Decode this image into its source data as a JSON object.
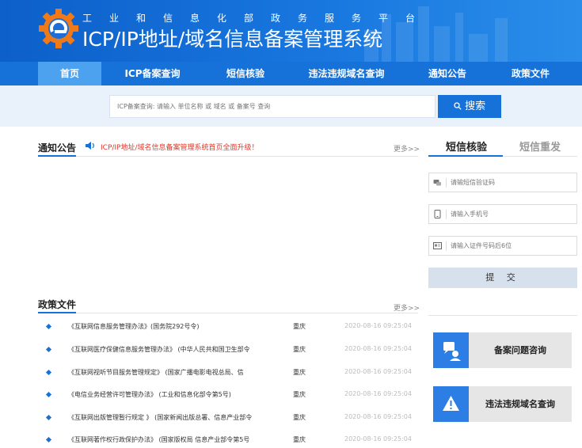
{
  "header": {
    "subtitle": "工业和信息化部政务服务平台",
    "title": "ICP/IP地址/域名信息备案管理系统"
  },
  "nav": {
    "items": [
      {
        "label": "首页",
        "active": true
      },
      {
        "label": "ICP备案查询"
      },
      {
        "label": "短信核验"
      },
      {
        "label": "违法违规域名查询"
      },
      {
        "label": "通知公告"
      },
      {
        "label": "政策文件"
      }
    ]
  },
  "search": {
    "placeholder": "ICP备案查询: 请输入 单位名称 或 域名 或 备案号 查询",
    "button_label": "搜索"
  },
  "notice": {
    "title": "通知公告",
    "headline": "ICP/IP地址/域名信息备案管理系统首页全面升级！",
    "more": "更多>>"
  },
  "sms": {
    "tabs": [
      {
        "label": "短信核验",
        "active": true
      },
      {
        "label": "短信重发",
        "active": false
      }
    ],
    "fields": [
      {
        "placeholder": "请输短信验证码",
        "icon": "chat-icon"
      },
      {
        "placeholder": "请输入手机号",
        "icon": "phone-icon"
      },
      {
        "placeholder": "请输入证件号码后6位",
        "icon": "id-card-icon"
      }
    ],
    "submit_label": "提 交"
  },
  "policy": {
    "title": "政策文件",
    "more": "更多>>",
    "rows": [
      {
        "title": "《互联网信息服务管理办法》(国务院292号令)",
        "region": "重庆",
        "date": "2020-08-16 09:25:04"
      },
      {
        "title": "《互联网医疗保健信息服务管理办法》 (中华人民共和国卫生部令",
        "region": "重庆",
        "date": "2020-08-16 09:25:04"
      },
      {
        "title": "《互联网视听节目服务管理规定》 (国家广播电影电视总局、信",
        "region": "重庆",
        "date": "2020-08-16 09:25:04"
      },
      {
        "title": "《电信业务经营许可管理办法》 (工业和信息化部令第5号)",
        "region": "重庆",
        "date": "2020-08-16 09:25:04"
      },
      {
        "title": "《互联网出版管理暂行规定 》 (国家新闻出版总署、信息产业部令",
        "region": "重庆",
        "date": "2020-08-16 09:25:04"
      },
      {
        "title": "《互联网著作权行政保护办法》 (国家版权局 信息产业部令第5号",
        "region": "重庆",
        "date": "2020-08-16 09:25:04"
      }
    ]
  },
  "side_buttons": [
    {
      "label": "备案问题咨询",
      "icon": "consult-icon"
    },
    {
      "label": "违法违规域名查询",
      "icon": "warning-icon"
    }
  ],
  "colors": {
    "primary": "#1671d9",
    "nav_active": "#4da2f0",
    "notice_red": "#e0382b",
    "search_band": "#e9f2fb"
  }
}
